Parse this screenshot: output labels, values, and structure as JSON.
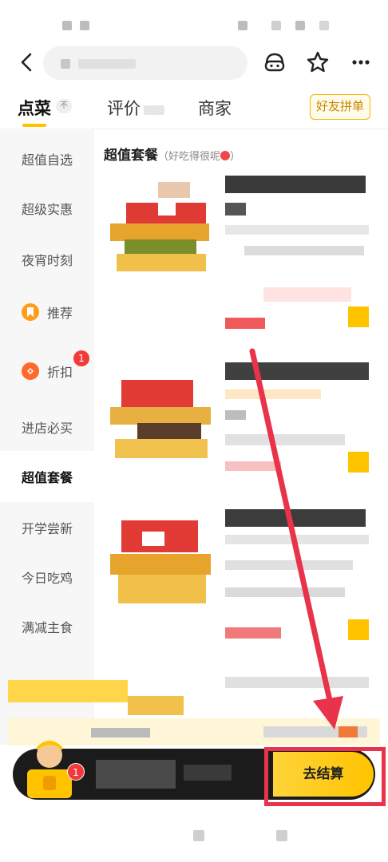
{
  "tabs": [
    {
      "label": "点菜",
      "active": true,
      "badge": "不"
    },
    {
      "label": "评价",
      "active": false
    },
    {
      "label": "商家",
      "active": false
    }
  ],
  "friends_button": "好友拼单",
  "sidebar": {
    "items": [
      {
        "label": "超值自选"
      },
      {
        "label": "超级实惠"
      },
      {
        "label": "夜宵时刻"
      },
      {
        "label": "推荐",
        "icon": "bookmark-icon"
      },
      {
        "label": "折扣",
        "icon": "discount-icon",
        "badge": "1"
      },
      {
        "label": "进店必买"
      },
      {
        "label": "超值套餐",
        "active": true
      },
      {
        "label": "开学尝新"
      },
      {
        "label": "今日吃鸡"
      },
      {
        "label": "满减主食"
      }
    ]
  },
  "section": {
    "title": "超值套餐",
    "subtitle": "（好吃得很呢",
    "subtitle_end": "）"
  },
  "cart": {
    "badge": "1",
    "checkout_label": "去结算"
  },
  "colors": {
    "accent": "#ffc300",
    "annotation": "#e8334a",
    "badge": "#f23a3a"
  }
}
